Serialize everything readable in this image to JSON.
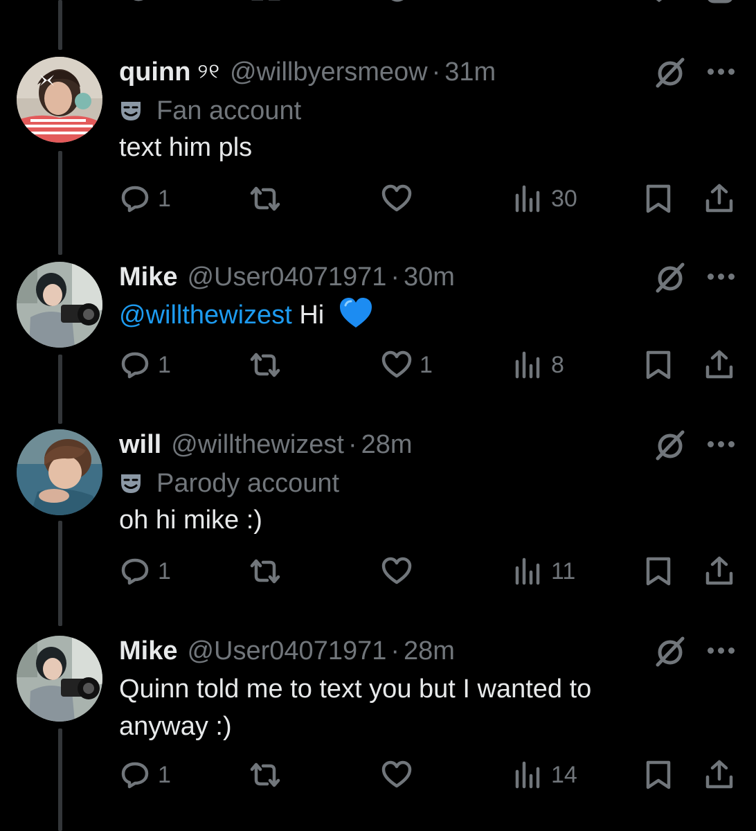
{
  "tweets": [
    {
      "display_name": "quinn",
      "name_emoji": "୨୧",
      "handle": "@willbyersmeow",
      "separator": "·",
      "time": "31m",
      "label": "Fan account",
      "text": "text him pls",
      "mention": "",
      "reply_count": "1",
      "retweet_count": "",
      "like_count": "",
      "view_count": "30"
    },
    {
      "display_name": "Mike",
      "name_emoji": "",
      "handle": "@User04071971",
      "separator": "·",
      "time": "30m",
      "label": "",
      "text": "Hi",
      "mention": "@willthewizest",
      "reply_count": "1",
      "retweet_count": "",
      "like_count": "1",
      "view_count": "8"
    },
    {
      "display_name": "will",
      "name_emoji": "",
      "handle": "@willthewizest",
      "separator": "·",
      "time": "28m",
      "label": "Parody account",
      "text": "oh hi mike :)",
      "mention": "",
      "reply_count": "1",
      "retweet_count": "",
      "like_count": "",
      "view_count": "11"
    },
    {
      "display_name": "Mike",
      "name_emoji": "",
      "handle": "@User04071971",
      "separator": "·",
      "time": "28m",
      "label": "",
      "text": "Quinn told me to text you but I wanted to anyway :)",
      "mention": "",
      "reply_count": "1",
      "retweet_count": "",
      "like_count": "",
      "view_count": "14"
    }
  ],
  "icons": {
    "reply": "reply-icon",
    "retweet": "retweet-icon",
    "like": "heart-icon",
    "views": "views-icon",
    "bookmark": "bookmark-icon",
    "share": "share-icon",
    "grok": "grok-icon",
    "more": "more-icon",
    "label": "theater-mask-icon"
  },
  "colors": {
    "background": "#000000",
    "text": "#e7e9ea",
    "muted": "#71767b",
    "link": "#1d9bf0",
    "thread_line": "#333639"
  }
}
